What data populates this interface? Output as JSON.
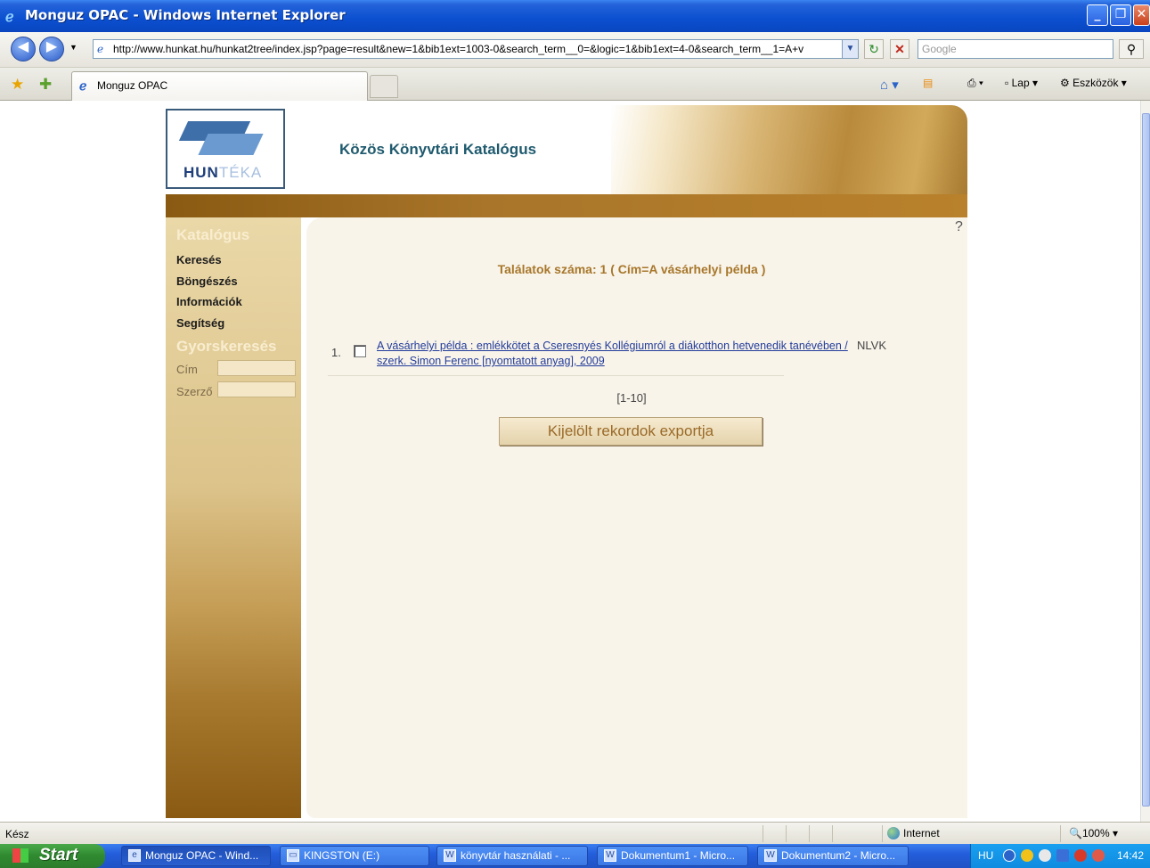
{
  "window": {
    "title": "Monguz OPAC - Windows Internet Explorer",
    "minimize": "_",
    "maximize": "❐",
    "close": "✕"
  },
  "address_bar": {
    "url": "http://www.hunkat.hu/hunkat2tree/index.jsp?page=result&new=1&bib1ext=1003-0&search_term__0=&logic=1&bib1ext=4-0&search_term__1=A+v",
    "search_placeholder": "Google"
  },
  "tab": {
    "label": "Monguz OPAC"
  },
  "toolbar": {
    "page_label": "Lap",
    "tools_label": "Eszközök"
  },
  "page": {
    "logo_text_bold": "HUN",
    "logo_text_light": "TÉKA",
    "site_title": "Közös Könyvtári Katalógus",
    "help": "?"
  },
  "sidebar": {
    "catalog_heading": "Katalógus",
    "items": [
      {
        "label": "Keresés"
      },
      {
        "label": "Böngészés"
      },
      {
        "label": "Információk"
      },
      {
        "label": "Segítség"
      }
    ],
    "quick_heading": "Gyorskeresés",
    "title_label": "Cím",
    "author_label": "Szerző"
  },
  "results": {
    "count_text": "Találatok száma: 1 ( Cím=A vásárhelyi példa )",
    "items": [
      {
        "number": "1.",
        "title": "A vásárhelyi példa : emlékkötet a Cseresnyés Kollégiumról a diákotthon hetvenedik tanévében / szerk. Simon Ferenc [nyomtatott anyag], 2009",
        "library": "NLVK"
      }
    ],
    "pager": "[1-10]",
    "export_button": "Kijelölt rekordok exportja"
  },
  "status_bar": {
    "status": "Kész",
    "zone": "Internet",
    "zoom": "100%"
  },
  "taskbar": {
    "start": "Start",
    "tasks": [
      {
        "label": "Monguz OPAC - Wind..."
      },
      {
        "label": "KINGSTON (E:)"
      },
      {
        "label": "könyvtár használati - ..."
      },
      {
        "label": "Dokumentum1 - Micro..."
      },
      {
        "label": "Dokumentum2 - Micro..."
      }
    ],
    "language": "HU",
    "clock": "14:42"
  }
}
